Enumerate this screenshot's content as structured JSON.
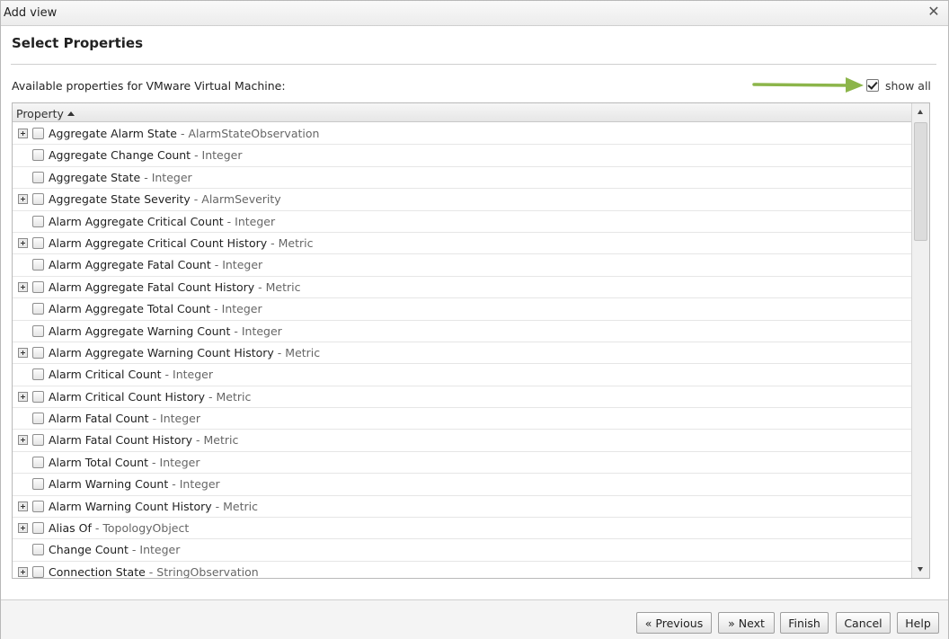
{
  "window": {
    "title": "Add view",
    "close_icon": "close-icon"
  },
  "header": {
    "title": "Select Properties"
  },
  "available_label": "Available properties for VMware Virtual Machine:",
  "show_all": {
    "label": "show all",
    "checked": true
  },
  "annotation": {
    "arrow_color": "#8cb54a"
  },
  "grid": {
    "column_header": "Property",
    "rows": [
      {
        "name": "Aggregate Alarm State",
        "type": " - AlarmStateObservation",
        "expandable": true
      },
      {
        "name": "Aggregate Change Count",
        "type": " - Integer",
        "expandable": false
      },
      {
        "name": "Aggregate State",
        "type": " - Integer",
        "expandable": false
      },
      {
        "name": "Aggregate State Severity",
        "type": " - AlarmSeverity",
        "expandable": true
      },
      {
        "name": "Alarm Aggregate Critical Count",
        "type": " - Integer",
        "expandable": false
      },
      {
        "name": "Alarm Aggregate Critical Count History",
        "type": " - Metric",
        "expandable": true
      },
      {
        "name": "Alarm Aggregate Fatal Count",
        "type": " - Integer",
        "expandable": false
      },
      {
        "name": "Alarm Aggregate Fatal Count History",
        "type": " - Metric",
        "expandable": true
      },
      {
        "name": "Alarm Aggregate Total Count",
        "type": " - Integer",
        "expandable": false
      },
      {
        "name": "Alarm Aggregate Warning Count",
        "type": " - Integer",
        "expandable": false
      },
      {
        "name": "Alarm Aggregate Warning Count History",
        "type": " - Metric",
        "expandable": true
      },
      {
        "name": "Alarm Critical Count",
        "type": " - Integer",
        "expandable": false
      },
      {
        "name": "Alarm Critical Count History",
        "type": " - Metric",
        "expandable": true
      },
      {
        "name": "Alarm Fatal Count",
        "type": " - Integer",
        "expandable": false
      },
      {
        "name": "Alarm Fatal Count History",
        "type": " - Metric",
        "expandable": true
      },
      {
        "name": "Alarm Total Count",
        "type": " - Integer",
        "expandable": false
      },
      {
        "name": "Alarm Warning Count",
        "type": " - Integer",
        "expandable": false
      },
      {
        "name": "Alarm Warning Count History",
        "type": " - Metric",
        "expandable": true
      },
      {
        "name": "Alias Of",
        "type": " - TopologyObject",
        "expandable": true
      },
      {
        "name": "Change Count",
        "type": " - Integer",
        "expandable": false
      },
      {
        "name": "Connection State",
        "type": " - StringObservation",
        "expandable": true
      }
    ]
  },
  "footer": {
    "previous_label": "« Previous",
    "next_label": "» Next",
    "finish_label": "Finish",
    "cancel_label": "Cancel",
    "help_label": "Help"
  }
}
